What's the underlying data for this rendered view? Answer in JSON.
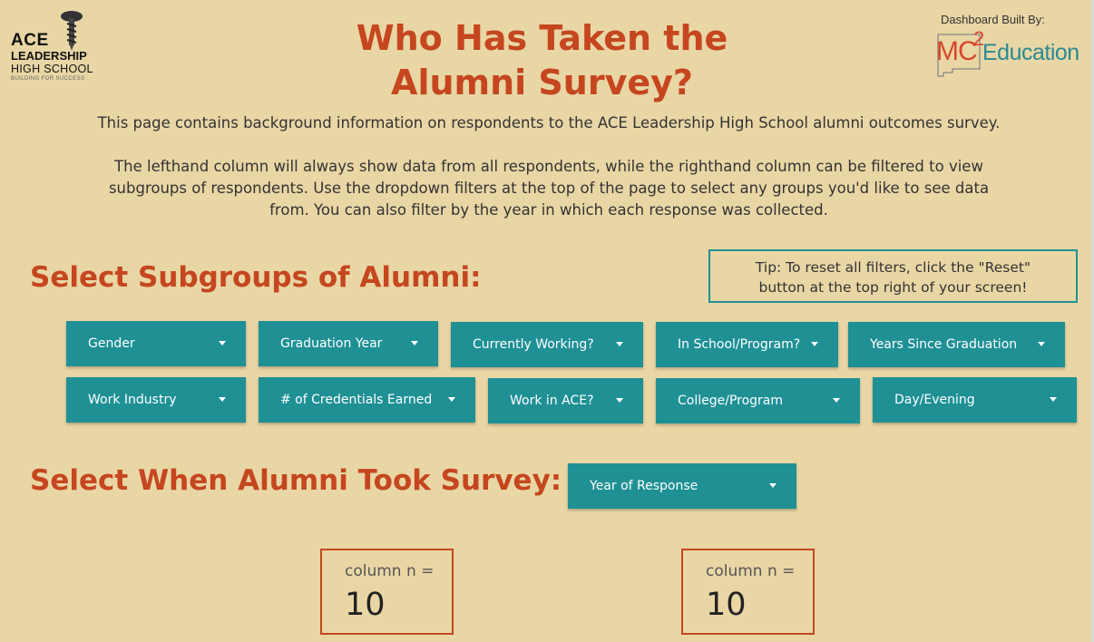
{
  "logos": {
    "ace_title": "ACE",
    "ace_line2": "LEADERSHIP",
    "ace_line3": "HIGH SCHOOL",
    "ace_tagline": "BUILDING FOR SUCCESS",
    "built_by": "Dashboard Built By:",
    "mc2_main": "MC",
    "mc2_sup": "2",
    "mc2_edu": "Education"
  },
  "header": {
    "title_line1": "Who Has Taken the",
    "title_line2": "Alumni Survey?"
  },
  "description": {
    "para1": "This page contains background information on respondents to the ACE Leadership High School alumni outcomes survey.",
    "para2_line1": "The lefthand column will always show data from all respondents, while the righthand column can be filtered to view",
    "para2_line2": "subgroups of respondents. Use the dropdown filters at the top of the page to select any groups you'd like to see data",
    "para2_line3": "from. You can also filter by the year in which each response was collected."
  },
  "sections": {
    "subgroups": "Select Subgroups of Alumni:",
    "when": "Select When Alumni Took Survey:"
  },
  "tip": {
    "line1": "Tip: To reset all filters, click the \"Reset\"",
    "line2": "button at the top right of your screen!"
  },
  "filters": {
    "row1": [
      "Gender",
      "Graduation Year",
      "Currently Working?",
      "In School/Program?",
      "Years Since Graduation"
    ],
    "row2": [
      "Work Industry",
      "# of Credentials Earned",
      "Work in ACE?",
      "College/Program",
      "Day/Evening"
    ],
    "year": "Year of Response"
  },
  "counts": {
    "left_label": "column n =",
    "left_value": "10",
    "right_label": "column n =",
    "right_value": "10"
  },
  "colors": {
    "background": "#e9d6a5",
    "accent": "#c5461f",
    "teal": "#1f9094"
  }
}
